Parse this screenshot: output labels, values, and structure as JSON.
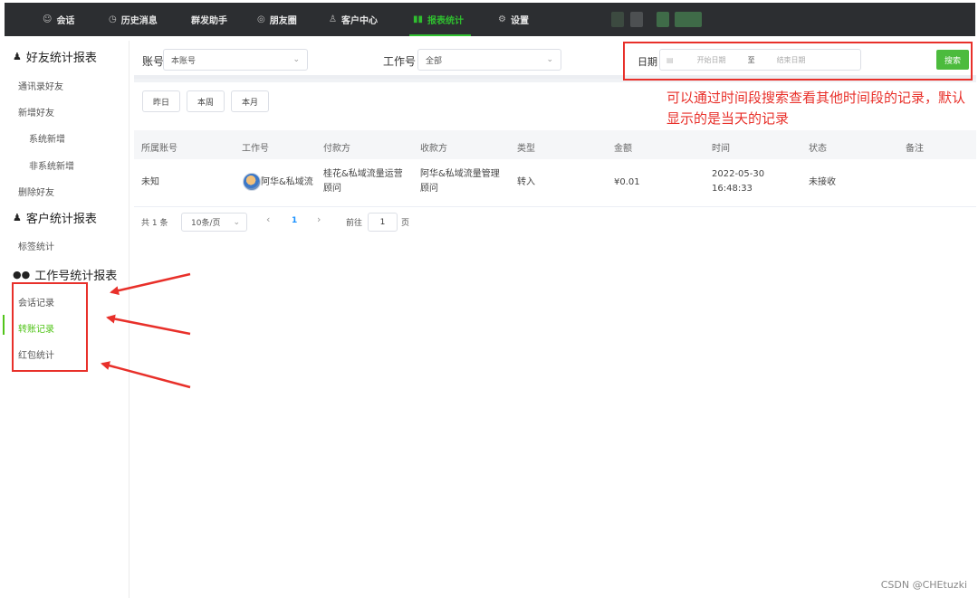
{
  "nav": {
    "items": [
      {
        "icon": "chat-icon",
        "glyph": "☺",
        "label": "会话"
      },
      {
        "icon": "clock-icon",
        "glyph": "◷",
        "label": "历史消息"
      },
      {
        "icon": "",
        "glyph": "",
        "label": "群发助手"
      },
      {
        "icon": "moments-icon",
        "glyph": "◎",
        "label": "朋友圈"
      },
      {
        "icon": "user-icon",
        "glyph": "♙",
        "label": "客户中心"
      },
      {
        "icon": "bar-chart-icon",
        "glyph": "▮▮",
        "label": "报表统计"
      },
      {
        "icon": "gear-icon",
        "glyph": "⚙",
        "label": "设置"
      }
    ],
    "active": "报表统计",
    "active_color": "#2fbf2f"
  },
  "sidebar": {
    "sections": [
      {
        "title": "好友统计报表",
        "icon": "person-icon",
        "glyph": "👤",
        "items": [
          "通讯录好友",
          "新增好友",
          "系统新增",
          "非系统新增",
          "删除好友"
        ]
      },
      {
        "title": "客户统计报表",
        "icon": "person-icon",
        "glyph": "👤",
        "items": [
          "标签统计"
        ]
      },
      {
        "title": "工作号统计报表",
        "icon": "wechat-icon",
        "glyph": "●",
        "items": [
          "会话记录",
          "转账记录",
          "红包统计"
        ]
      }
    ],
    "active_item": "转账记录",
    "active_color": "#52c41a"
  },
  "filters": {
    "account_label": "账号",
    "account_value": "本账号",
    "workno_label": "工作号",
    "workno_value": "全部",
    "date_label": "日期",
    "start_placeholder": "开始日期",
    "date_sep": "至",
    "end_placeholder": "结束日期",
    "search_button": "搜索",
    "quick": [
      "昨日",
      "本周",
      "本月"
    ]
  },
  "table": {
    "columns": [
      "所属账号",
      "工作号",
      "付款方",
      "收款方",
      "类型",
      "金额",
      "时间",
      "状态",
      "备注"
    ],
    "rows": [
      {
        "account": "未知",
        "workno": "阿华&私域流",
        "payer": "桂花&私域流量运营顾问",
        "payee": "阿华&私域流量管理顾问",
        "type": "转入",
        "amount": "¥0.01",
        "time": "2022-05-30 16:48:33",
        "status": "未接收",
        "note": ""
      }
    ]
  },
  "pager": {
    "total": "共 1 条",
    "page_size": "10条/页",
    "prev": "‹",
    "current": "1",
    "next": "›",
    "goto_label": "前往",
    "goto_value": "1",
    "page_unit": "页"
  },
  "annotation": {
    "text": "可以通过时间段搜索查看其他时间段的记录，默认显示的是当天的记录",
    "color": "#e8302a"
  },
  "watermark": "CSDN @CHEtuzki"
}
